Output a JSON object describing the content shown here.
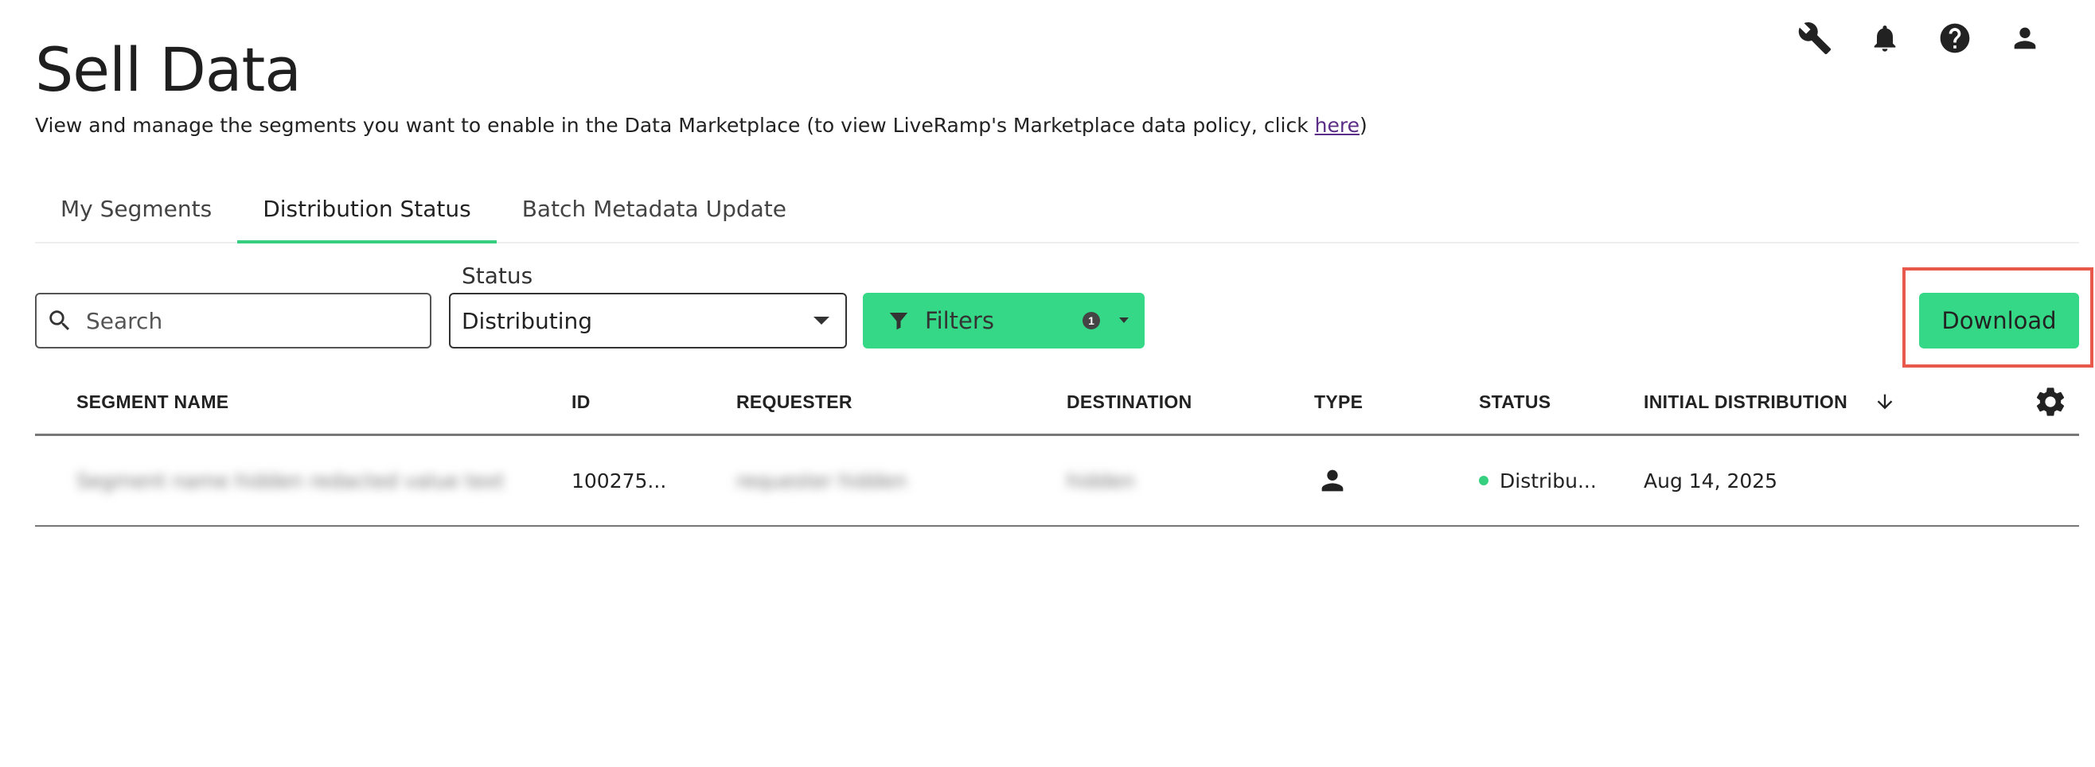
{
  "header": {
    "icons": [
      "wrench-icon",
      "bell-icon",
      "help-icon",
      "user-icon"
    ]
  },
  "page": {
    "title": "Sell Data",
    "subtitle_prefix": "View and manage the segments you want to enable in the Data Marketplace (to view LiveRamp's Marketplace data policy, click ",
    "subtitle_link": "here",
    "subtitle_suffix": ")"
  },
  "tabs": [
    {
      "label": "My Segments",
      "active": false
    },
    {
      "label": "Distribution Status",
      "active": true
    },
    {
      "label": "Batch Metadata Update",
      "active": false
    }
  ],
  "toolbar": {
    "search_placeholder": "Search",
    "status_label": "Status",
    "status_value": "Distributing",
    "filters_label": "Filters",
    "filters_count": "1",
    "download_label": "Download"
  },
  "table": {
    "columns": [
      "SEGMENT NAME",
      "ID",
      "REQUESTER",
      "DESTINATION",
      "TYPE",
      "STATUS",
      "INITIAL DISTRIBUTION"
    ],
    "rows": [
      {
        "segment_name": "Segment name hidden redacted value text",
        "id": "100275...",
        "requester": "requester hidden",
        "destination": "hidden",
        "type": "person-icon",
        "status": "Distribu...",
        "initial_distribution": "Aug 14, 2025"
      }
    ]
  },
  "colors": {
    "accent": "#35d886",
    "highlight": "#e8584b",
    "link": "#5b2d86"
  }
}
